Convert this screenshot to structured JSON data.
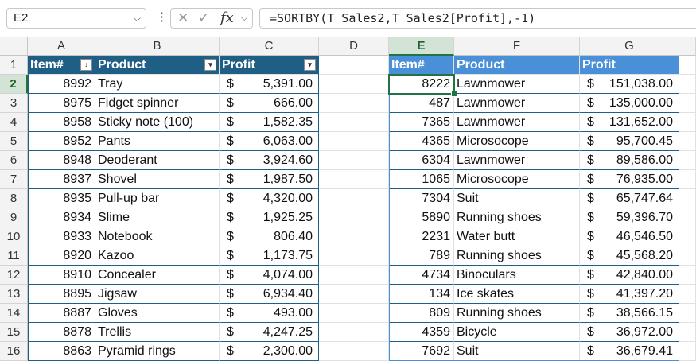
{
  "formula_bar": {
    "name_box": "E2",
    "formula": "=SORTBY(T_Sales2,T_Sales2[Profit],-1)",
    "cancel_glyph": "✕",
    "enter_glyph": "✓",
    "fx_label": "fx"
  },
  "columns": [
    "A",
    "B",
    "C",
    "D",
    "E",
    "F",
    "G"
  ],
  "rows": [
    "1",
    "2",
    "3",
    "4",
    "5",
    "6",
    "7",
    "8",
    "9",
    "10",
    "11",
    "12",
    "13",
    "14",
    "15",
    "16"
  ],
  "table1": {
    "headers": [
      "Item#",
      "Product",
      "Profit"
    ],
    "currency": "$",
    "rows": [
      [
        "8992",
        "Tray",
        "5,391.00"
      ],
      [
        "8975",
        "Fidget spinner",
        "666.00"
      ],
      [
        "8958",
        "Sticky note (100)",
        "1,582.35"
      ],
      [
        "8952",
        "Pants",
        "6,063.00"
      ],
      [
        "8948",
        "Deoderant",
        "3,924.60"
      ],
      [
        "8937",
        "Shovel",
        "1,987.50"
      ],
      [
        "8935",
        "Pull-up bar",
        "4,320.00"
      ],
      [
        "8934",
        "Slime",
        "1,925.25"
      ],
      [
        "8933",
        "Notebook",
        "806.40"
      ],
      [
        "8920",
        "Kazoo",
        "1,173.75"
      ],
      [
        "8910",
        "Concealer",
        "4,074.00"
      ],
      [
        "8895",
        "Jigsaw",
        "6,934.40"
      ],
      [
        "8887",
        "Gloves",
        "493.00"
      ],
      [
        "8878",
        "Trellis",
        "4,247.25"
      ],
      [
        "8863",
        "Pyramid rings",
        "2,300.00"
      ]
    ]
  },
  "table2": {
    "headers": [
      "Item#",
      "Product",
      "Profit"
    ],
    "currency": "$",
    "rows": [
      [
        "8222",
        "Lawnmower",
        "151,038.00"
      ],
      [
        "487",
        "Lawnmower",
        "135,000.00"
      ],
      [
        "7365",
        "Lawnmower",
        "131,652.00"
      ],
      [
        "4365",
        "Microsocope",
        "95,700.45"
      ],
      [
        "6304",
        "Lawnmower",
        "89,586.00"
      ],
      [
        "1065",
        "Microsocope",
        "76,935.00"
      ],
      [
        "7304",
        "Suit",
        "65,747.64"
      ],
      [
        "5890",
        "Running shoes",
        "59,396.70"
      ],
      [
        "2231",
        "Water butt",
        "46,546.50"
      ],
      [
        "789",
        "Running shoes",
        "45,568.20"
      ],
      [
        "4734",
        "Binoculars",
        "42,840.00"
      ],
      [
        "134",
        "Ice skates",
        "41,397.20"
      ],
      [
        "809",
        "Running shoes",
        "38,566.15"
      ],
      [
        "4359",
        "Bicycle",
        "36,972.00"
      ],
      [
        "7692",
        "Suit",
        "36,679.41"
      ]
    ]
  }
}
